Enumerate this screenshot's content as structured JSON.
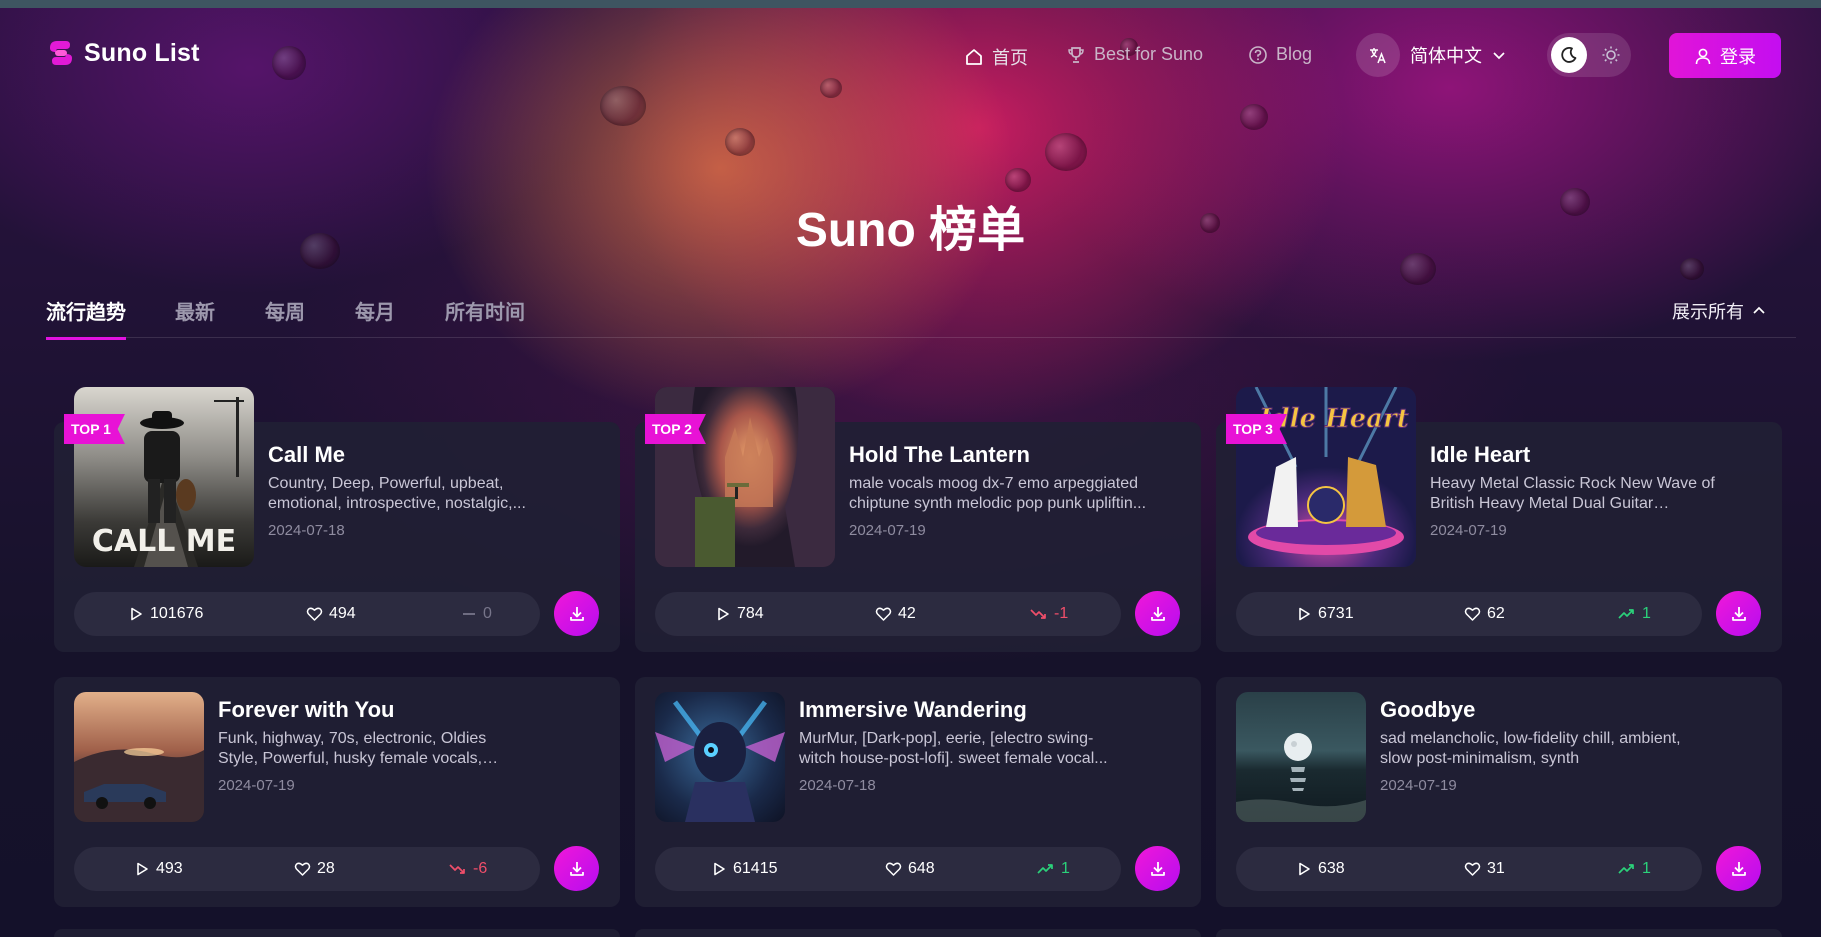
{
  "brand": {
    "name": "Suno List"
  },
  "nav": {
    "home": "首页",
    "best": "Best for Suno",
    "blog": "Blog",
    "language": "简体中文",
    "login": "登录"
  },
  "page": {
    "title": "Suno 榜单"
  },
  "tabs": [
    {
      "label": "流行趋势",
      "active": true
    },
    {
      "label": "最新"
    },
    {
      "label": "每周"
    },
    {
      "label": "每月"
    },
    {
      "label": "所有时间"
    }
  ],
  "show_all": "展示所有",
  "colors": {
    "accent": "#e112e0",
    "up": "#2bd17a",
    "down": "#f04e6a",
    "flat": "#77758a"
  },
  "songs": [
    {
      "badge": "TOP 1",
      "title": "Call Me",
      "tags": "Country, Deep, Powerful, upbeat, emotional, introspective, nostalgic,...",
      "date": "2024-07-18",
      "plays": "101676",
      "likes": "494",
      "rank": "0",
      "trend": "flat"
    },
    {
      "badge": "TOP 2",
      "title": "Hold The Lantern",
      "tags": "male vocals moog dx-7 emo arpeggiated chiptune synth melodic pop punk upliftin...",
      "date": "2024-07-19",
      "plays": "784",
      "likes": "42",
      "rank": "-1",
      "trend": "down"
    },
    {
      "badge": "TOP 3",
      "title": "Idle Heart",
      "tags": "Heavy Metal Classic Rock New Wave of British Heavy Metal Dual Guitar Harmonie...",
      "date": "2024-07-19",
      "plays": "6731",
      "likes": "62",
      "rank": "1",
      "trend": "up"
    },
    {
      "title": "Forever with You",
      "tags": "Funk, highway, 70s, electronic, Oldies Style, Powerful, husky female vocals, intonation,...",
      "date": "2024-07-19",
      "plays": "493",
      "likes": "28",
      "rank": "-6",
      "trend": "down"
    },
    {
      "title": "Immersive Wandering",
      "tags": "MurMur, [Dark-pop], eerie, [electro swing-witch house-post-lofi]. sweet female vocal...",
      "date": "2024-07-18",
      "plays": "61415",
      "likes": "648",
      "rank": "1",
      "trend": "up"
    },
    {
      "title": "Goodbye",
      "tags": "sad melancholic, low-fidelity chill, ambient, slow post-minimalism, synth",
      "date": "2024-07-19",
      "plays": "638",
      "likes": "31",
      "rank": "1",
      "trend": "up"
    }
  ],
  "cover_art_text": {
    "call_me": "CALL ME",
    "idle_heart": "Idle Heart"
  }
}
